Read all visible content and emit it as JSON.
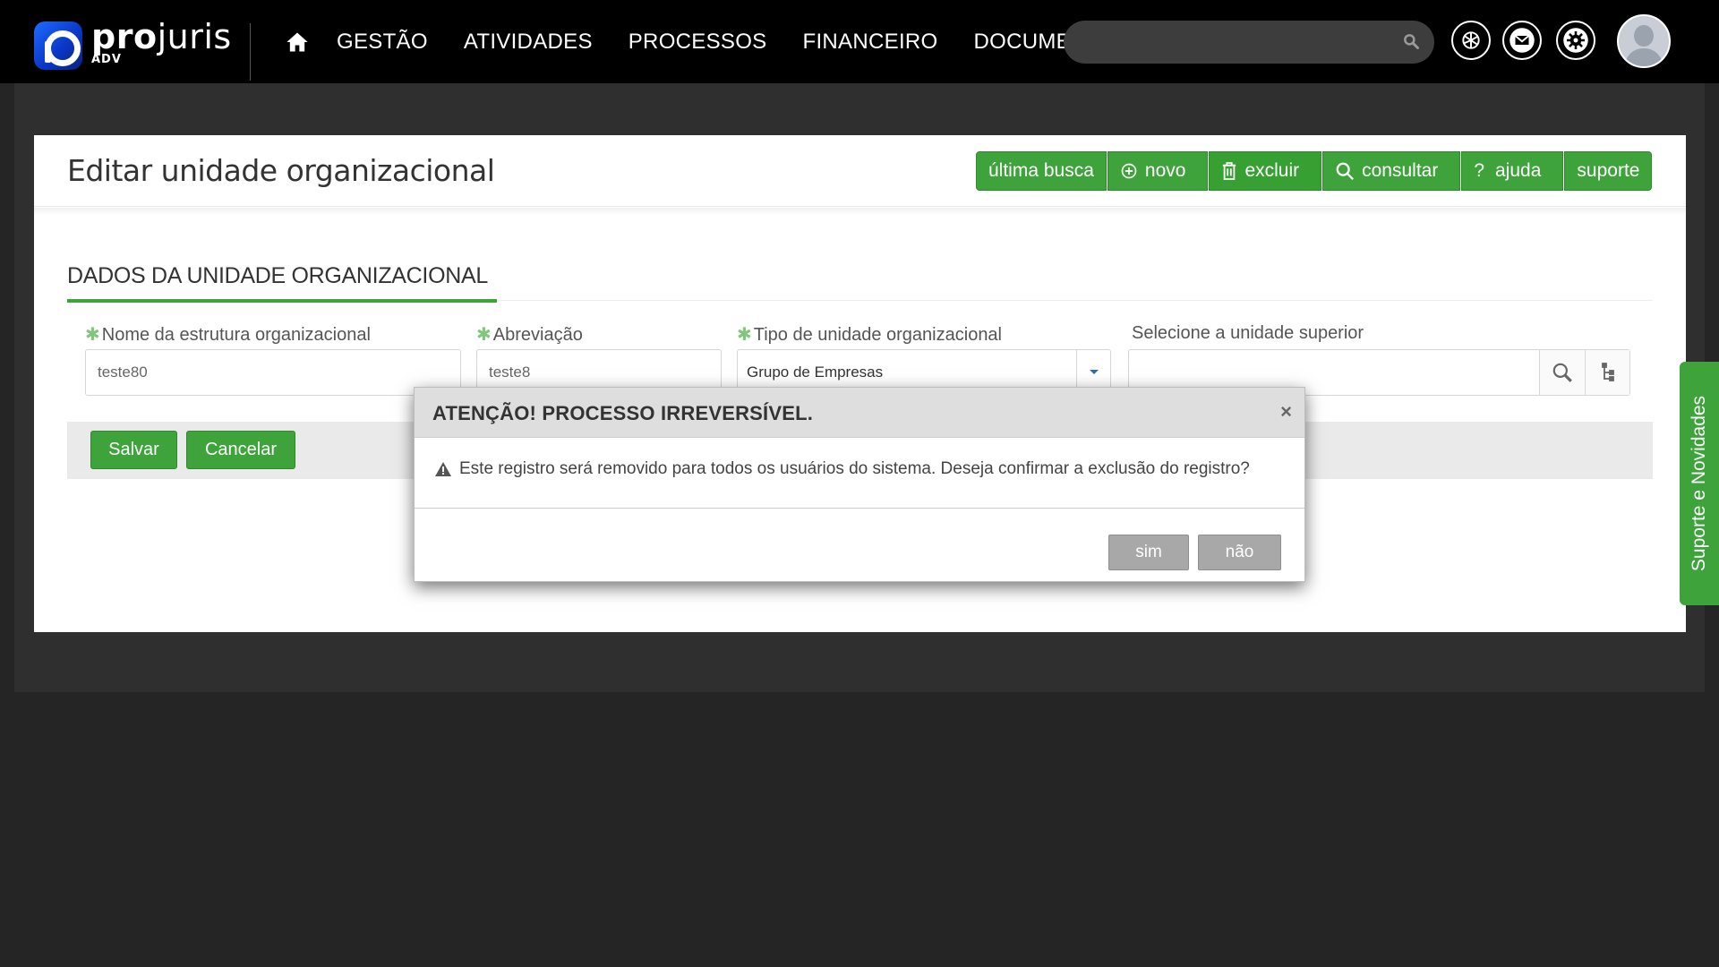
{
  "app": {
    "logo_name_bold": "pro",
    "logo_name_rest": "juris",
    "logo_sub": "ADV"
  },
  "nav": {
    "items": [
      "GESTÃO",
      "ATIVIDADES",
      "PROCESSOS",
      "FINANCEIRO",
      "DOCUMENTOS"
    ],
    "search_placeholder": ""
  },
  "page": {
    "title": "Editar unidade organizacional"
  },
  "toolbar": {
    "buttons": [
      {
        "label": "última busca",
        "icon": ""
      },
      {
        "label": "novo",
        "icon": "plus-circle-icon"
      },
      {
        "label": "excluir",
        "icon": "trash-icon"
      },
      {
        "label": "consultar",
        "icon": "search-icon"
      },
      {
        "label": "ajuda",
        "icon": "question-icon"
      },
      {
        "label": "suporte",
        "icon": ""
      }
    ]
  },
  "form": {
    "section_title": "DADOS DA UNIDADE ORGANIZACIONAL",
    "required_mark": "✱",
    "fields": {
      "nome": {
        "label": "Nome da estrutura organizacional",
        "value": "teste80",
        "required": true
      },
      "abreviacao": {
        "label": "Abreviação",
        "value": "teste8",
        "required": true
      },
      "tipo": {
        "label": "Tipo de unidade organizacional",
        "value": "Grupo de Empresas",
        "required": true
      },
      "superior": {
        "label": "Selecione a unidade superior",
        "value": "",
        "required": false
      }
    },
    "save_label": "Salvar",
    "cancel_label": "Cancelar"
  },
  "support_tab": {
    "label": "Suporte e Novidades"
  },
  "modal": {
    "title": "ATENÇÃO! PROCESSO IRREVERSÍVEL.",
    "close": "×",
    "message": "Este registro será removido para todos os usuários do sistema. Deseja confirmar a exclusão do registro?",
    "yes_label": "sim",
    "no_label": "não"
  },
  "colors": {
    "accent_green": "#3ea33a",
    "topbar": "#000000",
    "background": "#252525",
    "modal_button": "#a8a8a8"
  }
}
